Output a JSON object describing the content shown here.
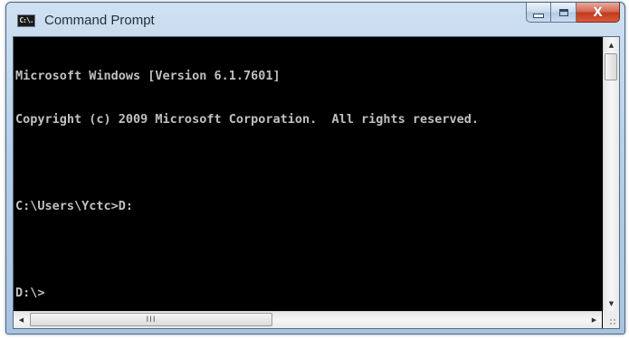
{
  "window": {
    "title": "Command Prompt",
    "icon_name": "cmd-app-icon",
    "icon_text": "C:\\.",
    "controls": {
      "minimize_icon": "minimize-icon",
      "maximize_icon": "maximize-icon",
      "close_icon": "close-icon",
      "close_glyph": "X"
    },
    "close_color": "#c8401f"
  },
  "console": {
    "background": "#000000",
    "foreground": "#c0c0c0",
    "lines": [
      "Microsoft Windows [Version 6.1.7601]",
      "Copyright (c) 2009 Microsoft Corporation.  All rights reserved.",
      "",
      "C:\\Users\\Yctc>D:",
      "",
      "D:\\>"
    ]
  },
  "scrollbars": {
    "vertical": {
      "up_glyph": "▲",
      "down_glyph": "▼"
    },
    "horizontal": {
      "left_glyph": "◀",
      "right_glyph": "▶",
      "grip": "III"
    }
  }
}
